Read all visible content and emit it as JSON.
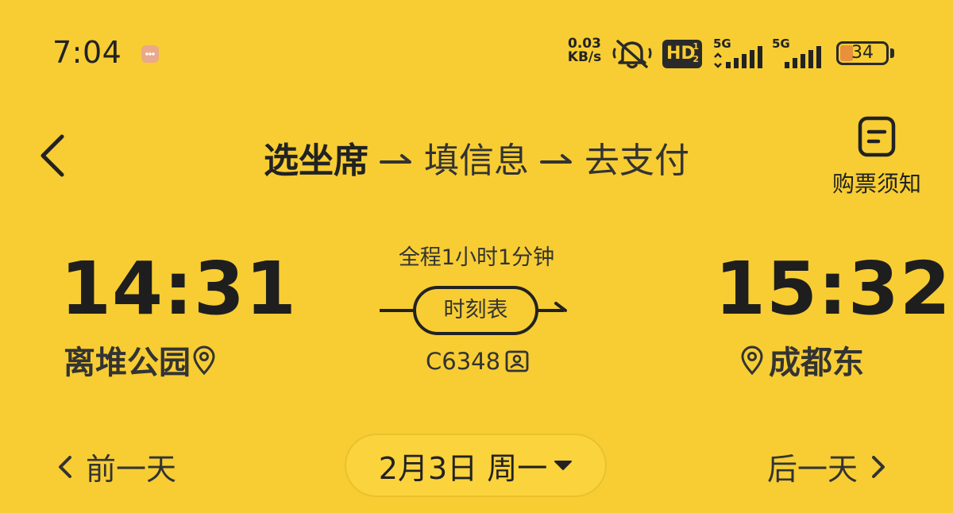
{
  "status_bar": {
    "time": "7:04",
    "net_speed_value": "0.03",
    "net_speed_unit": "KB/s",
    "signal_1_label": "5G",
    "signal_2_label": "5G",
    "battery_level": "34"
  },
  "header": {
    "steps": [
      "选坐席",
      "填信息",
      "去支付"
    ],
    "active_step": 0,
    "notice_label": "购票须知"
  },
  "trip": {
    "departure_time": "14:31",
    "departure_station": "离堆公园",
    "arrival_time": "15:32",
    "arrival_station": "成都东",
    "duration": "全程1小时1分钟",
    "timetable_label": "时刻表",
    "train_number": "C6348"
  },
  "date_bar": {
    "prev_label": "前一天",
    "date_label": "2月3日 周一",
    "next_label": "后一天"
  },
  "colors": {
    "background": "#F7CD33",
    "text": "#222222",
    "battery_fill": "#E8913A"
  }
}
